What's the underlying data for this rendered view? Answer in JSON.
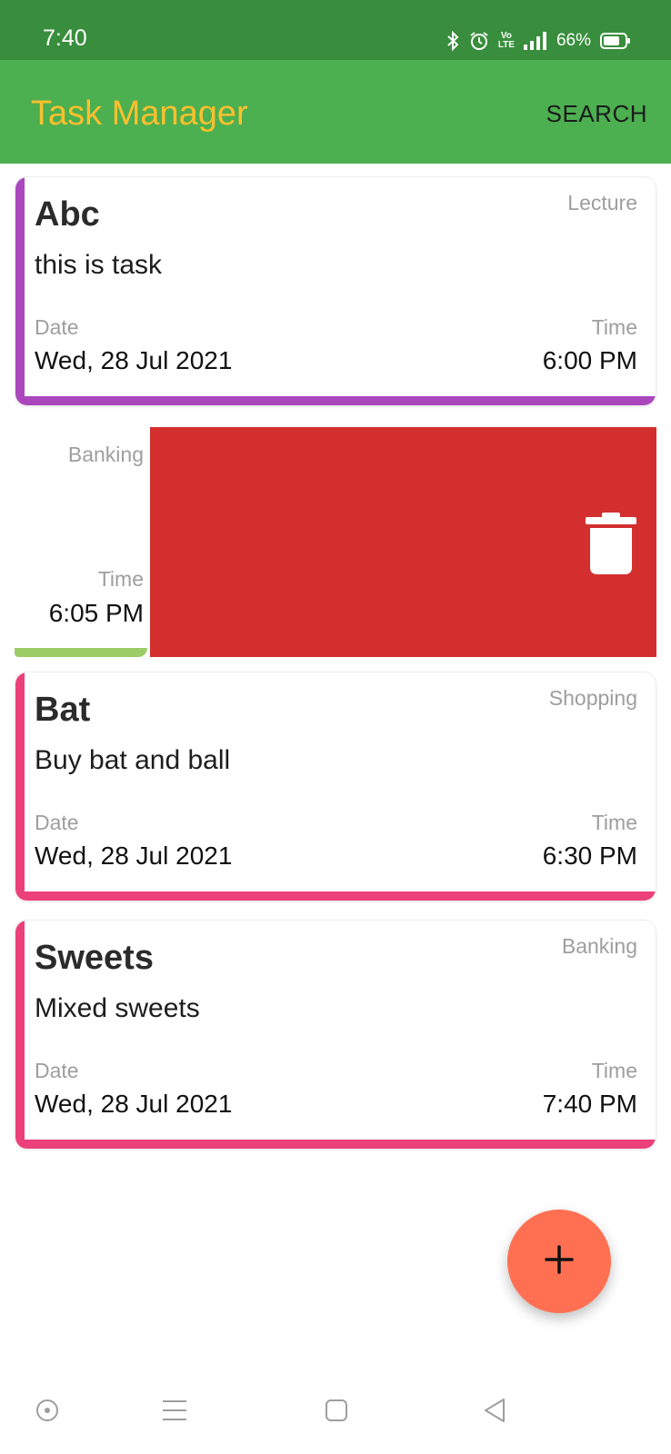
{
  "status_bar": {
    "time": "7:40",
    "volte_line1": "Vo",
    "volte_line2": "LTE",
    "battery": "66%"
  },
  "app_bar": {
    "title": "Task Manager",
    "search_label": "SEARCH",
    "background": "#4caf50",
    "title_color": "#fbc02d"
  },
  "tasks": [
    {
      "title": "Abc",
      "description": "this is task",
      "category": "Lecture",
      "date_label": "Date",
      "date": "Wed, 28 Jul 2021",
      "time_label": "Time",
      "time": "6:00 PM",
      "color": "#ab47bc"
    },
    {
      "category": "Banking",
      "time_label": "Time",
      "time": "6:05 PM",
      "color": "#9ccc65",
      "swiped": true
    },
    {
      "title": "Bat",
      "description": "Buy bat and ball",
      "category": "Shopping",
      "date_label": "Date",
      "date": "Wed, 28 Jul 2021",
      "time_label": "Time",
      "time": "6:30 PM",
      "color": "#ec407a"
    },
    {
      "title": "Sweets",
      "description": "Mixed sweets",
      "category": "Banking",
      "date_label": "Date",
      "date": "Wed, 28 Jul 2021",
      "time_label": "Time",
      "time": "7:40 PM",
      "color": "#ec407a"
    }
  ],
  "delete_action": {
    "icon": "trash-icon",
    "background": "#d32f2f"
  },
  "fab": {
    "icon": "plus-icon",
    "background": "#ff7052"
  },
  "nav_bar": {
    "icons": [
      "assistant-icon",
      "menu-icon",
      "home-square-icon",
      "back-triangle-icon"
    ]
  }
}
